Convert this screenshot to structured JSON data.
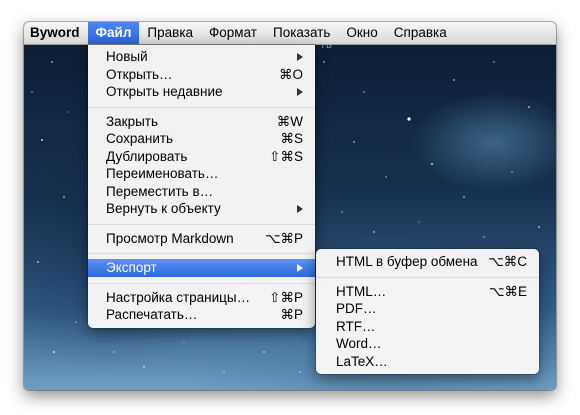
{
  "menubar": {
    "app": "Byword",
    "items": [
      "Файл",
      "Правка",
      "Формат",
      "Показать",
      "Окно",
      "Справка"
    ],
    "active": "Файл"
  },
  "background_fragment": "ТЬ",
  "file_menu": {
    "items": [
      {
        "label": "Новый",
        "submenu": true
      },
      {
        "label": "Открыть…",
        "shortcut": "⌘O"
      },
      {
        "label": "Открыть недавние",
        "submenu": true
      },
      {
        "label": "Закрыть",
        "shortcut": "⌘W"
      },
      {
        "label": "Сохранить",
        "shortcut": "⌘S"
      },
      {
        "label": "Дублировать",
        "shortcut": "⇧⌘S"
      },
      {
        "label": "Переименовать…"
      },
      {
        "label": "Переместить в…"
      },
      {
        "label": "Вернуть к объекту",
        "submenu": true
      },
      {
        "label": "Просмотр Markdown",
        "shortcut": "⌥⌘P"
      },
      {
        "label": "Экспорт",
        "submenu": true,
        "highlighted": true
      },
      {
        "label": "Настройка страницы…",
        "shortcut": "⇧⌘P"
      },
      {
        "label": "Распечатать…",
        "shortcut": "⌘P"
      }
    ]
  },
  "export_submenu": {
    "items": [
      {
        "label": "HTML в буфер обмена",
        "shortcut": "⌥⌘C"
      },
      {
        "label": "HTML…",
        "shortcut": "⌥⌘E"
      },
      {
        "label": "PDF…"
      },
      {
        "label": "RTF…"
      },
      {
        "label": "Word…"
      },
      {
        "label": "LaTeX…"
      }
    ]
  },
  "colors": {
    "highlight": "#3a74e6",
    "menu_bg": "#f6f6f6",
    "desktop": "#1c3858"
  }
}
